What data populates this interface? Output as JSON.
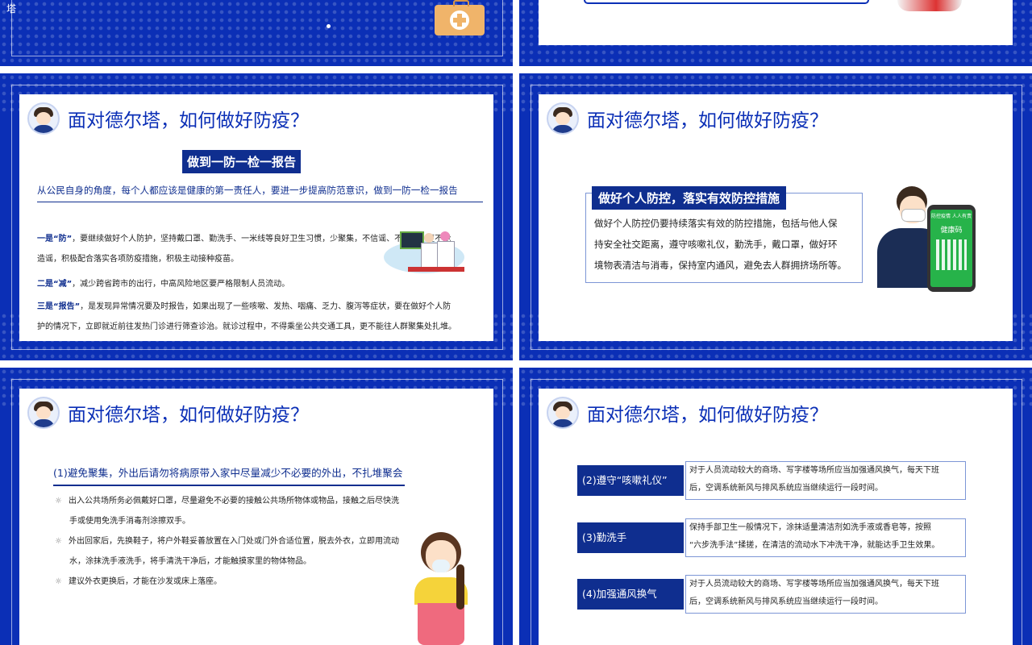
{
  "slide_top_left": {
    "title_fragment": "塔"
  },
  "slide_title": "面对德尔塔，如何做好防疫？",
  "slide_mid_left": {
    "heading": "做到一防一检一报告",
    "intro": "从公民自身的角度，每个人都应该是健康的第一责任人，要进一步提高防范意识，做到一防一检一报告",
    "p1_lead": "一是“防”",
    "p1_line1": "，要继续做好个人防护，坚持戴口罩、勤洗手、一米线等良好卫生习惯，少聚集，不信谣、不传谣，更不能",
    "p1_line2": "造谣，积极配合落实各项防疫措施，积极主动接种疫苗。",
    "p2_lead": "二是“减”",
    "p2_text": "，减少跨省跨市的出行，中高风险地区要严格限制人员流动。",
    "p3_lead": "三是“报告”",
    "p3_line1": "，是发现异常情况要及时报告，如果出现了一些咳嗽、发热、咽痛、乏力、腹泻等症状，要在做好个人防",
    "p3_line2": "护的情况下，立即就近前往发热门诊进行筛查诊治。就诊过程中，不得乘坐公共交通工具，更不能往人群聚集处扎堆。"
  },
  "slide_mid_right": {
    "heading": "做好个人防控，落实有效防控措施",
    "line1": "做好个人防控仍要持续落实有效的防控措施，包括与他人保",
    "line2": "持安全社交距离，遵守咳嗽礼仪，勤洗手，戴口罩，做好环",
    "line3": "境物表清洁与消毒，保持室内通风，避免去人群拥挤场所等。",
    "phone_header": "防控疫情 人人有责",
    "phone_code": "健康码"
  },
  "slide_bot_left": {
    "heading": "(1)避免聚集，外出后请勿将病原带入家中尽量减少不必要的外出，不扎堆聚会",
    "b1_line1": "出入公共场所务必佩戴好口罩，尽量避免不必要的接触公共场所物体或物品，接触之后尽快洗",
    "b1_line2": "手或使用免洗手消毒剂涂擦双手。",
    "b2_line1": "外出回家后，先换鞋子，将户外鞋妥善放置在入门处或门外合适位置，脱去外衣，立即用流动",
    "b2_line2": "水，涂抹洗手液洗手，将手清洗干净后，才能触摸家里的物体物品。",
    "b3_line1": "建议外衣更换后，才能在沙发或床上落座。",
    "bullet_icon": "☼"
  },
  "slide_bot_right": {
    "rows": [
      {
        "label": "(2)遵守“咳嗽礼仪”",
        "line1": "对于人员流动较大的商场、写字楼等场所应当加强通风换气，每天下班",
        "line2": "后，空调系统新风与排风系统应当继续运行一段时间。"
      },
      {
        "label": "(3)勤洗手",
        "line1": "保持手部卫生一般情况下，涂抹适量清洁剂如洗手液或香皂等，按照",
        "line2": "“六步洗手法”揉搓，在清洁的流动水下冲洗干净，就能达手卫生效果。"
      },
      {
        "label": "(4)加强通风换气",
        "line1": "对于人员流动较大的商场、写字楼等场所应当加强通风换气，每天下班",
        "line2": "后，空调系统新风与排风系统应当继续运行一段时间。"
      }
    ]
  },
  "colors": {
    "brand_blue": "#0b2fb6",
    "label_blue": "#0f2e8f",
    "white": "#ffffff"
  },
  "icons": [
    "medical-kit-icon",
    "avatar-icon",
    "sun-bullet-icon",
    "phone-qr-icon"
  ]
}
